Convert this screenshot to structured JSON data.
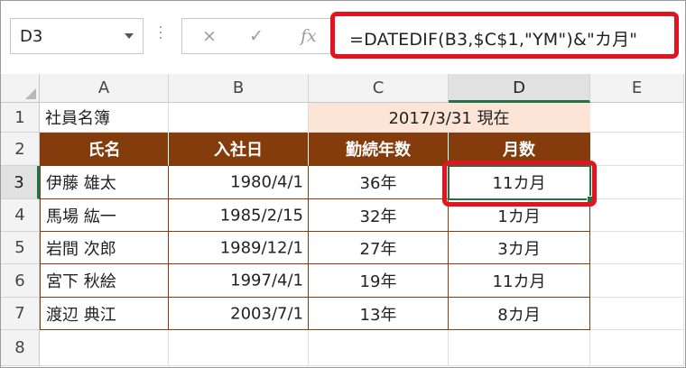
{
  "formula_bar": {
    "name_box": "D3",
    "cancel_icon": "×",
    "enter_icon": "✓",
    "fx_label": "fx",
    "formula": "=DATEDIF(B3,$C$1,\"YM\")&\"カ月\""
  },
  "columns": [
    "A",
    "B",
    "C",
    "D",
    "E"
  ],
  "rows": [
    "1",
    "2",
    "3",
    "4",
    "5",
    "6",
    "7",
    "8"
  ],
  "sheet": {
    "a1": "社員名簿",
    "c1": "2017/3/31 現在",
    "headers": [
      "氏名",
      "入社日",
      "勤続年数",
      "月数"
    ],
    "records": [
      {
        "name": "伊藤 雄太",
        "date": "1980/4/1",
        "years": "36年",
        "months": "11カ月"
      },
      {
        "name": "馬場 紘一",
        "date": "1985/2/15",
        "years": "32年",
        "months": "1カ月"
      },
      {
        "name": "岩間 次郎",
        "date": "1989/12/1",
        "years": "27年",
        "months": "3カ月"
      },
      {
        "name": "宮下 秋絵",
        "date": "1997/4/1",
        "years": "19年",
        "months": "11カ月"
      },
      {
        "name": "渡辺 典江",
        "date": "2003/7/1",
        "years": "13年",
        "months": "8カ月"
      }
    ]
  },
  "colors": {
    "header_fill": "#843c0c",
    "date_fill": "#fce4d6",
    "highlight": "#e3141f",
    "selection": "#217346"
  }
}
